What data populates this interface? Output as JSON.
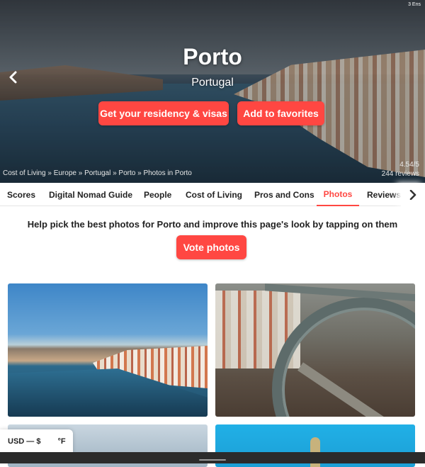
{
  "hero": {
    "status_text": "3 Ens",
    "city": "Porto",
    "country": "Portugal",
    "residency_button": "Get your residency & visas",
    "favorites_button": "Add to favorites",
    "breadcrumb": "Cost of Living » Europe » Portugal » Porto » Photos in Porto",
    "rating": "4.54/5",
    "reviews": "244 reviews"
  },
  "tabs": [
    {
      "label": "Scores",
      "active": false
    },
    {
      "label": "Digital Nomad Guide",
      "active": false
    },
    {
      "label": "People",
      "active": false
    },
    {
      "label": "Cost of Living",
      "active": false
    },
    {
      "label": "Pros and Cons",
      "active": false
    },
    {
      "label": "Photos",
      "active": true
    },
    {
      "label": "Reviews",
      "active": false
    }
  ],
  "main": {
    "prompt": "Help pick the best photos for Porto and improve this page's look by tapping on them",
    "vote_button": "Vote photos"
  },
  "footer": {
    "currency": "USD — $",
    "temperature_unit": "°F"
  },
  "colors": {
    "accent": "#ff4742",
    "text": "#222222"
  }
}
